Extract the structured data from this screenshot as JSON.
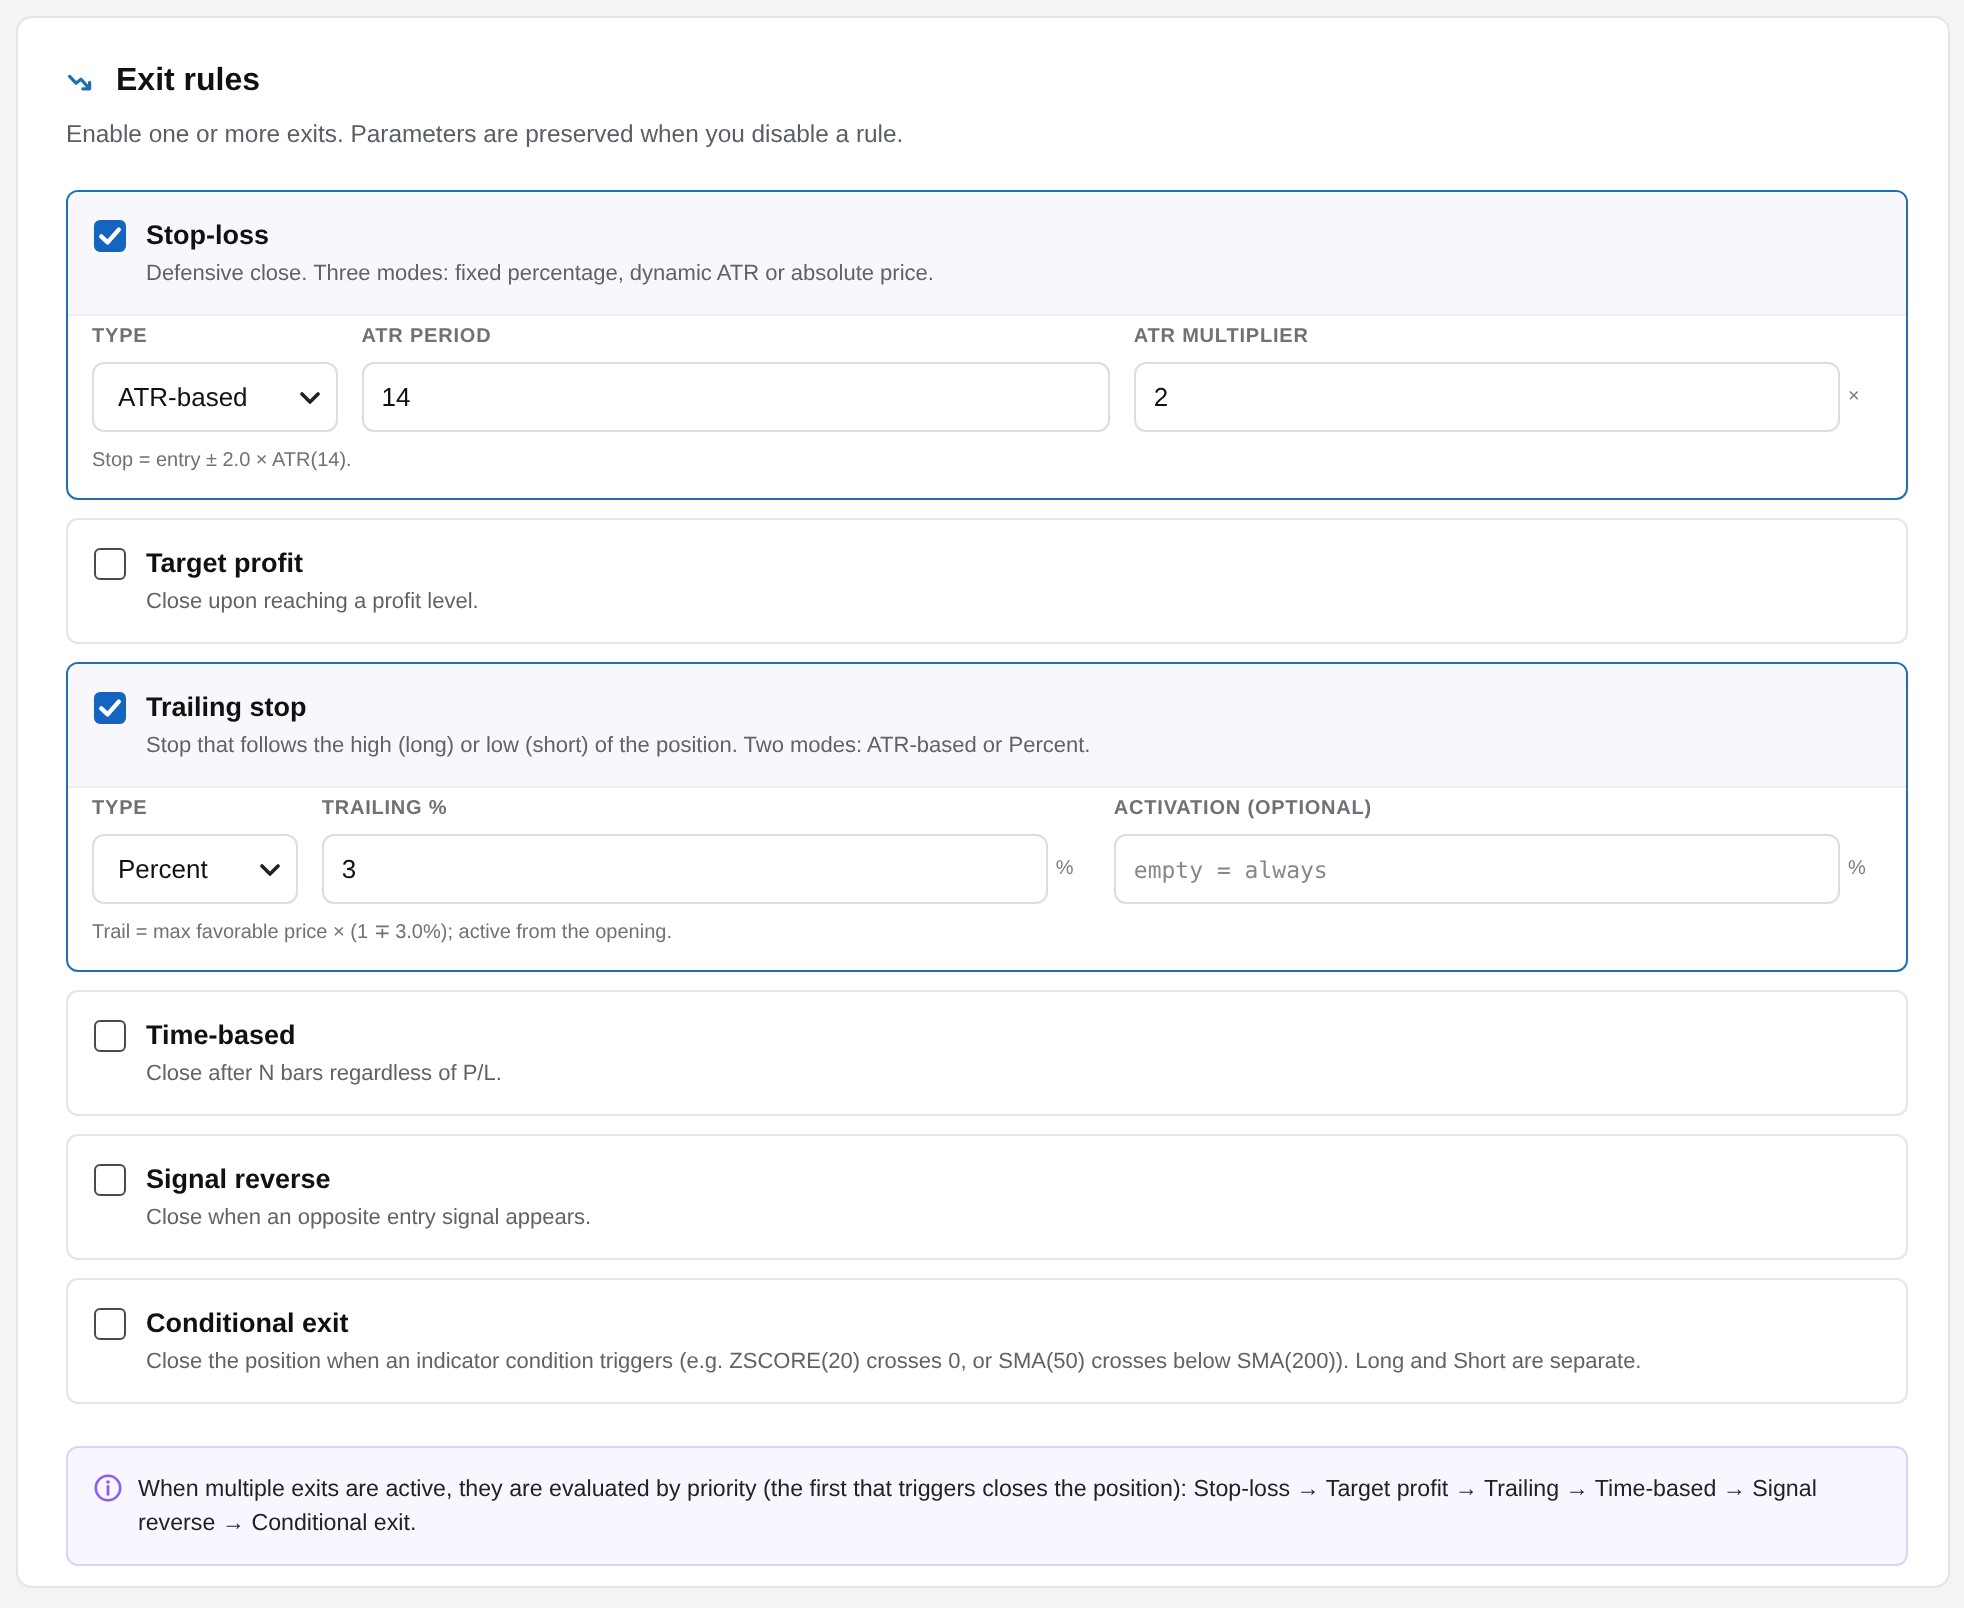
{
  "section": {
    "title": "Exit rules",
    "subtitle": "Enable one or more exits. Parameters are preserved when you disable a rule."
  },
  "rules": [
    {
      "title": "Stop-loss",
      "description": "Defensive close. Three modes: fixed percentage, dynamic ATR or absolute price.",
      "checked": true,
      "fields": [
        {
          "kind": "select",
          "label": "TYPE",
          "value": "ATR-based"
        },
        {
          "kind": "number",
          "label": "ATR PERIOD",
          "value": "14"
        },
        {
          "kind": "number",
          "label": "ATR MULTIPLIER",
          "value": "2",
          "suffix": "×"
        }
      ],
      "hint": "Stop = entry ± 2.0 × ATR(14)."
    },
    {
      "title": "Target profit",
      "description": "Close upon reaching a profit level.",
      "checked": false
    },
    {
      "title": "Trailing stop",
      "description": "Stop that follows the high (long) or low (short) of the position. Two modes: ATR-based or Percent.",
      "checked": true,
      "fields": [
        {
          "kind": "select",
          "label": "TYPE",
          "value": "Percent"
        },
        {
          "kind": "number",
          "label": "TRAILING %",
          "value": "3",
          "suffix": "%"
        },
        {
          "kind": "number",
          "label": "ACTIVATION (OPTIONAL)",
          "placeholder": "empty = always",
          "suffix": "%"
        }
      ],
      "hint": "Trail = max favorable price × (1 ∓ 3.0%); active from the opening."
    },
    {
      "title": "Time-based",
      "description": "Close after N bars regardless of P/L.",
      "checked": false
    },
    {
      "title": "Signal reverse",
      "description": "Close when an opposite entry signal appears.",
      "checked": false
    },
    {
      "title": "Conditional exit",
      "description": "Close the position when an indicator condition triggers (e.g. ZSCORE(20) crosses 0, or SMA(50) crosses below SMA(200)). Long and Short are separate.",
      "checked": false
    }
  ],
  "notice": {
    "text": "When multiple exits are active, they are evaluated by priority (the first that triggers closes the position): Stop-loss → Target profit → Trailing → Time-based → Signal reverse → Conditional exit."
  }
}
